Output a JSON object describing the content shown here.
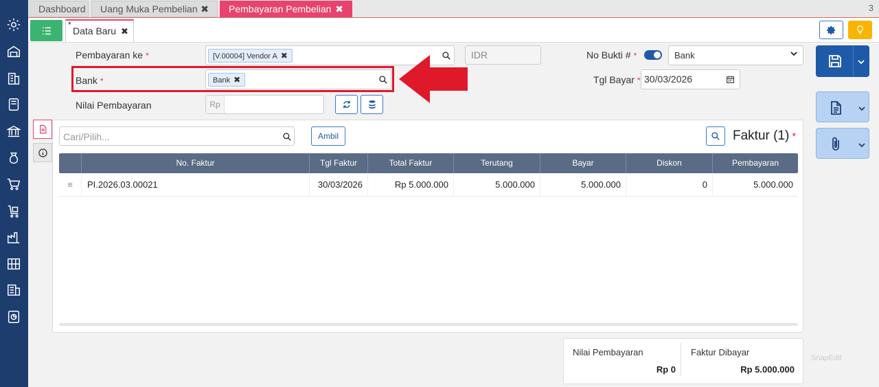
{
  "tabs": [
    {
      "label": "Dashboard",
      "closable": false,
      "active": false
    },
    {
      "label": "Uang Muka Pembelian",
      "closable": true,
      "active": false
    },
    {
      "label": "Pembayaran Pembelian",
      "closable": true,
      "active": true
    }
  ],
  "tab_close_glyph": "✖",
  "tab_count": "3",
  "form_tab": {
    "modified_mark": "*",
    "label": "Data Baru",
    "close_glyph": "✖"
  },
  "form": {
    "pembayaran_ke_label": "Pembayaran ke",
    "pembayaran_ke_value": "[V.00004] Vendor A",
    "currency": "IDR",
    "bank_label": "Bank",
    "bank_value": "Bank",
    "nilai_label": "Nilai Pembayaran",
    "nilai_prefix": "Rp",
    "no_bukti_label": "No Bukti #",
    "no_bukti_select": "Bank",
    "tgl_bayar_label": "Tgl Bayar",
    "tgl_bayar_value": "30/03/2026",
    "required_mark": "*"
  },
  "panel": {
    "search_placeholder": "Cari/Pilih...",
    "ambil_label": "Ambil",
    "faktur_title": "Faktur (1)",
    "columns": [
      "No. Faktur",
      "Tgl Faktur",
      "Total Faktur",
      "Terutang",
      "Bayar",
      "Diskon",
      "Pembayaran"
    ],
    "rows": [
      {
        "no_faktur": "PI.2026.03.00021",
        "tgl_faktur": "30/03/2026",
        "total_faktur": "Rp 5.000.000",
        "terutang": "5.000.000",
        "bayar": "5.000.000",
        "diskon": "0",
        "pembayaran": "5.000.000"
      }
    ],
    "row_handle_glyph": "≡"
  },
  "summary": {
    "nilai_label": "Nilai Pembayaran",
    "nilai_value": "Rp 0",
    "faktur_label": "Faktur Dibayar",
    "faktur_value": "Rp 5.000.000"
  },
  "watermark": "SnapEdit",
  "colors": {
    "sidebar": "#1c3d6e",
    "accent_pink": "#e8436d",
    "primary_blue": "#1e5aa8",
    "highlight_red": "#e0192a"
  },
  "icons": [
    "gear-icon",
    "warehouse-icon",
    "building-icon",
    "tablet-icon",
    "bank-icon",
    "money-bag-icon",
    "cart-icon",
    "cart-box-icon",
    "factory-icon",
    "shelves-icon",
    "tax-icon",
    "report-icon"
  ]
}
